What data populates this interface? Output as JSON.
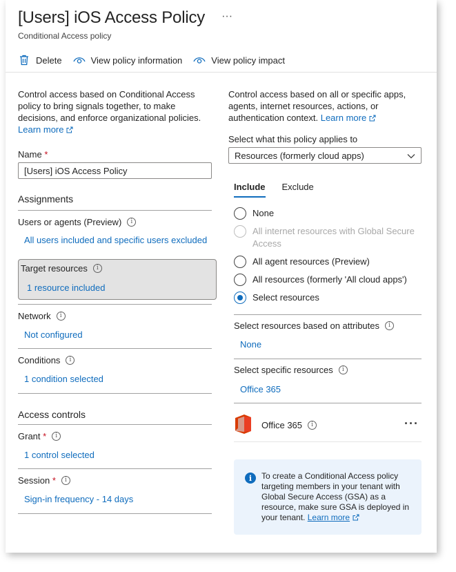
{
  "header": {
    "title": "[Users] iOS Access Policy",
    "ellipsis": "···",
    "subtitle": "Conditional Access policy"
  },
  "toolbar": {
    "delete_label": "Delete",
    "view_info_label": "View policy information",
    "view_impact_label": "View policy impact"
  },
  "left": {
    "description": "Control access based on Conditional Access policy to bring signals together, to make decisions, and enforce organizational policies.",
    "learn_more": "Learn more",
    "name_label": "Name",
    "required_mark": "*",
    "name_value": "[Users] iOS Access Policy",
    "assignments_title": "Assignments",
    "users_title": "Users or agents (Preview)",
    "users_value": "All users included and specific users excluded",
    "target_title": "Target resources",
    "target_value": "1 resource included",
    "network_title": "Network",
    "network_value": "Not configured",
    "conditions_title": "Conditions",
    "conditions_value": "1 condition selected",
    "access_controls_title": "Access controls",
    "grant_title": "Grant",
    "grant_value": "1 control selected",
    "session_title": "Session",
    "session_value": "Sign-in frequency - 14 days"
  },
  "right": {
    "description": "Control access based on all or specific apps, agents, internet resources, actions, or authentication context.",
    "learn_more": "Learn more",
    "select_label": "Select what this policy applies to",
    "select_value": "Resources (formerly cloud apps)",
    "tabs": [
      {
        "label": "Include",
        "active": true
      },
      {
        "label": "Exclude",
        "active": false
      }
    ],
    "radios": [
      {
        "label": "None",
        "state": "unchecked"
      },
      {
        "label": "All internet resources with Global Secure Access",
        "state": "disabled"
      },
      {
        "label": "All agent resources (Preview)",
        "state": "unchecked"
      },
      {
        "label": "All resources (formerly 'All cloud apps')",
        "state": "unchecked"
      },
      {
        "label": "Select resources",
        "state": "checked"
      }
    ],
    "attributes_title": "Select resources based on attributes",
    "attributes_value": "None",
    "specific_title": "Select specific resources",
    "specific_value": "Office 365",
    "app_name": "Office 365",
    "more_label": "···",
    "info_text": "To create a Conditional Access policy targeting members in your tenant with Global Secure Access (GSA) as a resource, make sure GSA is deployed in your tenant.",
    "info_link": "Learn more"
  },
  "colors": {
    "accent": "#0f6cbd",
    "required": "#c50f1f",
    "selected_bg": "#e3e3e3",
    "info_bg": "#ebf3fc",
    "office_red": "#d83b01"
  },
  "icons": [
    "trash-icon",
    "eye-icon",
    "external-link-icon",
    "info-icon",
    "chevron-down-icon",
    "office-logo-icon",
    "more-icon"
  ]
}
